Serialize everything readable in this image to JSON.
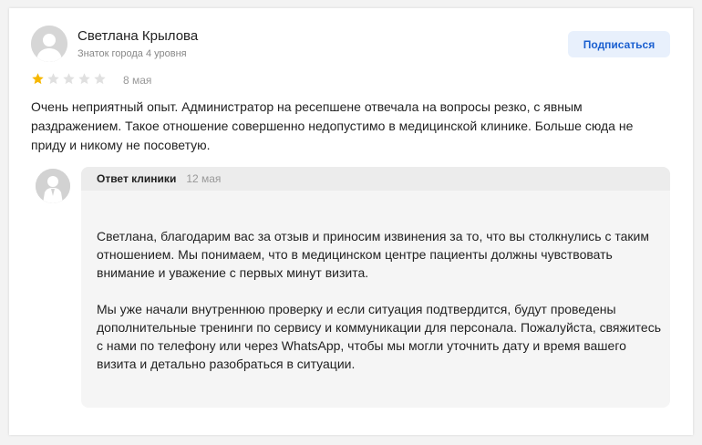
{
  "review": {
    "author_name": "Светлана Крылова",
    "author_rank": "Знаток города 4 уровня",
    "subscribe_label": "Подписаться",
    "rating": 1,
    "rating_max": 5,
    "date": "8 мая",
    "text": "Очень неприятный опыт. Администратор на ресепшене отвечала на вопросы резко, с явным раздражением. Такое отношение совершенно недопустимо в медицинской клинике. Больше сюда не приду и никому не посоветую."
  },
  "reply": {
    "author": "Ответ клиники",
    "date": "12 мая",
    "paragraphs": [
      "Светлана, благодарим вас за отзыв и приносим извинения за то, что вы столкнулись с таким отношением. Мы понимаем, что в медицинском центре пациенты должны чувствовать внимание и уважение с первых минут визита.",
      "Мы уже начали внутреннюю проверку и если ситуация подтвердится, будут проведены дополнительные тренинги по сервису и коммуникации для персонала. Пожалуйста, свяжитесь с нами по телефону или через WhatsApp, чтобы мы могли уточнить дату и время вашего визита и детально разобраться в ситуации."
    ]
  },
  "icons": {
    "user_avatar": "user-avatar-icon",
    "clinic_avatar": "clinic-avatar-icon",
    "star": "star-icon"
  },
  "colors": {
    "star_filled": "#f6b700",
    "star_empty": "#e0e0e0",
    "accent": "#1a5fd0"
  }
}
